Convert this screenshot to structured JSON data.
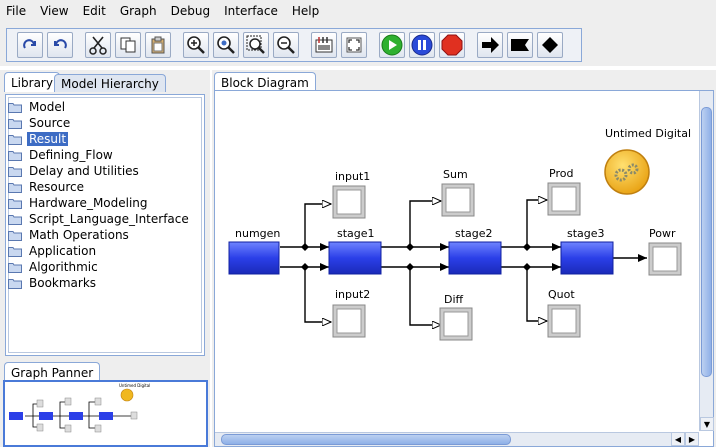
{
  "menu": [
    "File",
    "View",
    "Edit",
    "Graph",
    "Debug",
    "Interface",
    "Help"
  ],
  "toolbar": {
    "buttons": [
      "redo-icon",
      "undo-icon",
      "cut-icon",
      "copy-icon",
      "paste-icon",
      "zoom-in-icon",
      "zoom-reset-icon",
      "zoom-fit-icon",
      "zoom-out-icon",
      "layout-icon",
      "fullscreen-icon",
      "run-icon",
      "pause-icon",
      "stop-icon",
      "arrow-right-icon",
      "flag-icon",
      "diamond-icon"
    ]
  },
  "library": {
    "tabs": [
      "Library",
      "Model Hierarchy"
    ],
    "items": [
      "Model",
      "Source",
      "Result",
      "Defining_Flow",
      "Delay and Utilities",
      "Resource",
      "Hardware_Modeling",
      "Script_Language_Interface",
      "Math Operations",
      "Application",
      "Algorithmic",
      "Bookmarks"
    ],
    "selected": "Result"
  },
  "panner": {
    "tab": "Graph Panner"
  },
  "diagram": {
    "tab": "Block Diagram",
    "director": "Untimed Digital",
    "actors": {
      "numgen": "numgen",
      "stage1": "stage1",
      "stage2": "stage2",
      "stage3": "stage3",
      "input1": "input1",
      "input2": "input2",
      "sum": "Sum",
      "diff": "Diff",
      "prod": "Prod",
      "quot": "Quot",
      "powr": "Powr"
    }
  },
  "colors": {
    "actor": "#2b3fe8",
    "accent": "#4a7ad8",
    "director": "#f0b820"
  }
}
